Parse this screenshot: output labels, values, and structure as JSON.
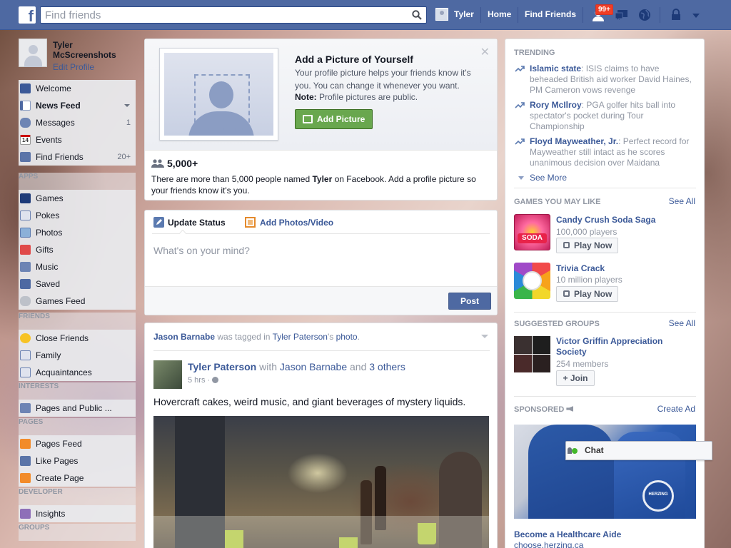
{
  "topbar": {
    "logo_letter": "f",
    "search_placeholder": "Find friends",
    "user_name": "Tyler",
    "home_label": "Home",
    "find_friends_label": "Find Friends",
    "friend_requests_badge": "99+",
    "icons": [
      "facebook-logo-icon",
      "search-icon",
      "friend-requests-icon",
      "messages-icon",
      "notifications-globe-icon",
      "privacy-lock-icon",
      "settings-caret-icon"
    ]
  },
  "leftnav": {
    "profile_name": "Tyler McScreenshots",
    "edit_profile": "Edit Profile",
    "items": [
      {
        "label": "Welcome",
        "count": ""
      },
      {
        "label": "News Feed",
        "count": ""
      },
      {
        "label": "Messages",
        "count": "1"
      },
      {
        "label": "Events",
        "count": ""
      },
      {
        "label": "Find Friends",
        "count": "20+"
      }
    ],
    "events_icon_date": "14",
    "apps_header": "APPS",
    "apps": [
      {
        "label": "Games"
      },
      {
        "label": "Pokes"
      },
      {
        "label": "Photos"
      },
      {
        "label": "Gifts"
      },
      {
        "label": "Music"
      },
      {
        "label": "Saved"
      },
      {
        "label": "Games Feed"
      }
    ],
    "friends_header": "FRIENDS",
    "friends": [
      {
        "label": "Close Friends"
      },
      {
        "label": "Family"
      },
      {
        "label": "Acquaintances"
      }
    ],
    "interests_header": "INTERESTS",
    "interests": [
      {
        "label": "Pages and Public ..."
      }
    ],
    "pages_header": "PAGES",
    "pages": [
      {
        "label": "Pages Feed"
      },
      {
        "label": "Like Pages"
      },
      {
        "label": "Create Page"
      }
    ],
    "developer_header": "DEVELOPER",
    "developer": [
      {
        "label": "Insights"
      }
    ],
    "groups_header": "GROUPS"
  },
  "addpic": {
    "title": "Add a Picture of Yourself",
    "text": "Your profile picture helps your friends know it's you. You can change it whenever you want.",
    "note_label": "Note:",
    "note_text": " Profile pictures are public.",
    "button": "Add Picture",
    "people_count": "5,000+",
    "people_desc_pre": "There are more than 5,000 people named ",
    "people_desc_name": "Tyler",
    "people_desc_post": " on Facebook. Add a profile picture so your friends know it's you."
  },
  "composer": {
    "tab_status": "Update Status",
    "tab_photos": "Add Photos/Video",
    "placeholder": "What's on your mind?",
    "post_button": "Post"
  },
  "story": {
    "tagger": "Jason Barnabe",
    "tagged_text": " was tagged in ",
    "owner": "Tyler Paterson",
    "owner_suffix": "'s ",
    "photo_word": "photo",
    "period": ".",
    "author": "Tyler Paterson",
    "with_word": " with ",
    "with_person": "Jason Barnabe",
    "and_word": " and ",
    "others": "3 others",
    "time": "5 hrs · ",
    "text": "Hovercraft cakes, weird music, and giant beverages of mystery liquids."
  },
  "rightcol": {
    "trending_header": "TRENDING",
    "trends": [
      {
        "name": "Islamic state",
        "desc": ": ISIS claims to have beheaded British aid worker David Haines, PM Cameron vows revenge"
      },
      {
        "name": "Rory McIlroy",
        "desc": ": PGA golfer hits ball into spectator's pocket during Tour Championship"
      },
      {
        "name": "Floyd Mayweather, Jr.",
        "desc": ": Perfect record for Mayweather still intact as he scores unanimous decision over Maidana"
      }
    ],
    "see_more": "See More",
    "games_header": "GAMES YOU MAY LIKE",
    "see_all": "See All",
    "games": [
      {
        "name": "Candy Crush Soda Saga",
        "players": "100,000 players",
        "button": "Play Now",
        "icon_text": "SODA"
      },
      {
        "name": "Trivia Crack",
        "players": "10 million players",
        "button": "Play Now"
      }
    ],
    "groups_header": "SUGGESTED GROUPS",
    "group": {
      "name": "Victor Griffin Appreciation Society",
      "members": "254 members",
      "button": "+ Join"
    },
    "sponsored_header": "SPONSORED",
    "create_ad": "Create Ad",
    "ad": {
      "title": "Become a Healthcare Aide",
      "url": "choose.herzing.ca",
      "logo_text": "HERZING"
    }
  },
  "chat": {
    "label": "Chat"
  },
  "colors": {
    "brand": "#4e69a2",
    "link": "#3b5998",
    "green_button": "#69a74e",
    "badge": "#f03d25"
  }
}
